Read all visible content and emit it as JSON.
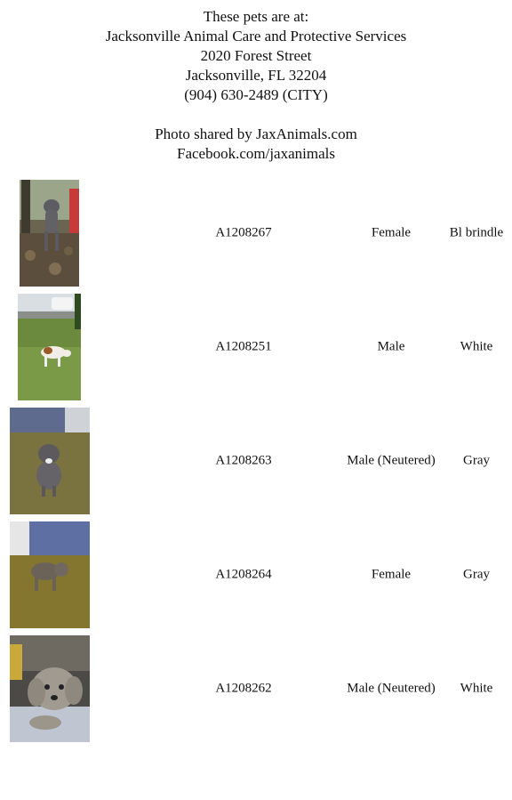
{
  "header": {
    "line1": "These pets are at:",
    "line2": "Jacksonville Animal Care and Protective Services",
    "line3": "2020 Forest Street",
    "line4": "Jacksonville, FL 32204",
    "line5": "(904) 630-2489 (CITY)",
    "line6": "Photo shared by JaxAnimals.com",
    "line7": "Facebook.com/jaxanimals"
  },
  "pets": [
    {
      "id": "A1208267",
      "sex": "Female",
      "color": "Bl brindle",
      "photo": "gray dog standing in wooded area"
    },
    {
      "id": "A1208251",
      "sex": "Male",
      "color": "White",
      "photo": "white and brown dog on grass"
    },
    {
      "id": "A1208263",
      "sex": "Male (Neutered)",
      "color": "Gray",
      "photo": "gray dog in kennel"
    },
    {
      "id": "A1208264",
      "sex": "Female",
      "color": "Gray",
      "photo": "gray dog in kennel"
    },
    {
      "id": "A1208262",
      "sex": "Male (Neutered)",
      "color": "White",
      "photo": "shaggy gray dog lying on towel"
    }
  ]
}
